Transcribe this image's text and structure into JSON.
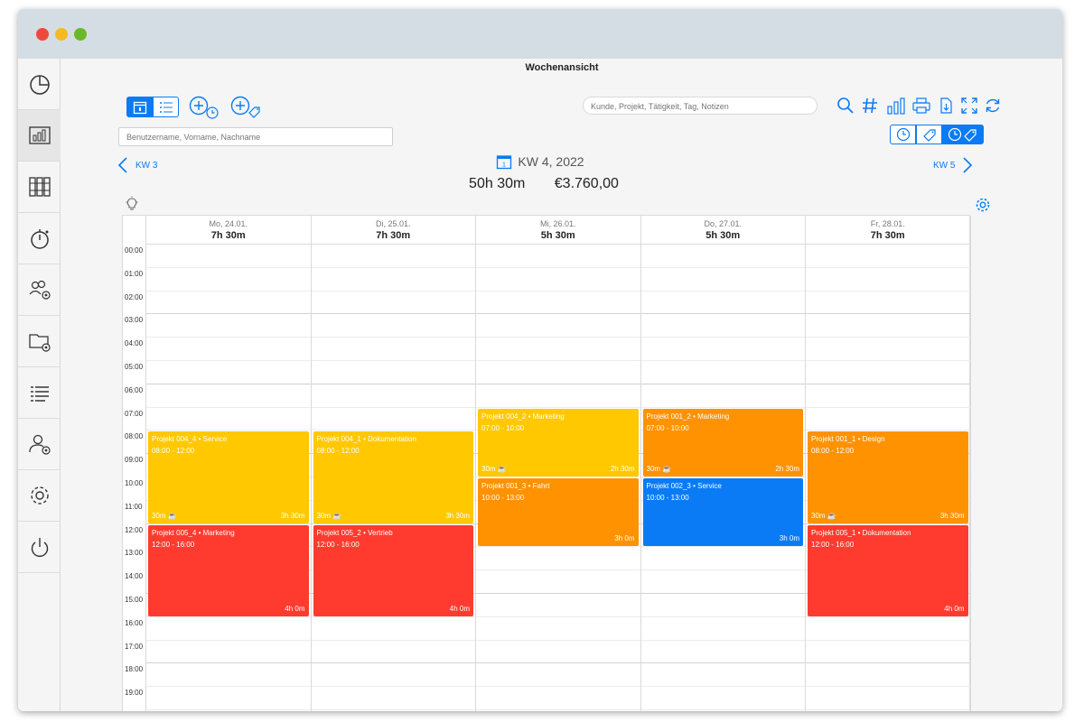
{
  "window": {
    "title": "Wochenansicht"
  },
  "sidebar": {
    "items": [
      {
        "icon": "pie-chart-icon"
      },
      {
        "icon": "bar-chart-icon"
      },
      {
        "icon": "binders-icon"
      },
      {
        "icon": "stopwatch-icon"
      },
      {
        "icon": "users-settings-icon"
      },
      {
        "icon": "folder-settings-icon"
      },
      {
        "icon": "list-icon"
      },
      {
        "icon": "user-settings-icon"
      },
      {
        "icon": "gear-icon"
      },
      {
        "icon": "power-icon"
      }
    ]
  },
  "toolbar": {
    "search_placeholder": "Kunde, Projekt, Tätigkeit, Tag, Notizen",
    "user_placeholder": "Benutzername, Vorname, Nachname"
  },
  "week": {
    "prev": "KW 3",
    "next": "KW 5",
    "label": "KW 4, 2022",
    "calendar_icon_day": "1",
    "total_hours": "50h 30m",
    "total_amount": "€3.760,00"
  },
  "days": [
    {
      "name": "Mo, 24.01.",
      "total": "7h 30m"
    },
    {
      "name": "Di, 25.01.",
      "total": "7h 30m"
    },
    {
      "name": "Mi, 26.01.",
      "total": "5h 30m"
    },
    {
      "name": "Do, 27.01.",
      "total": "5h 30m"
    },
    {
      "name": "Fr, 28.01.",
      "total": "7h 30m"
    }
  ],
  "hours": [
    "00:00",
    "01:00",
    "02:00",
    "03:00",
    "04:00",
    "05:00",
    "06:00",
    "07:00",
    "08:00",
    "09:00",
    "10:00",
    "11:00",
    "12:00",
    "13:00",
    "14:00",
    "15:00",
    "16:00",
    "17:00",
    "18:00",
    "19:00"
  ],
  "colors": {
    "yellow": "#ffc800",
    "orange": "#ff9200",
    "red": "#ff3b30",
    "blue": "#0a7bf5",
    "accent": "#0a7bf5"
  },
  "events": [
    {
      "day": 0,
      "title": "Projekt 004_4 • Service",
      "time": "08:00 - 12:00",
      "start": 8,
      "end": 12,
      "color": "yellow",
      "pause": "30m",
      "duration": "3h 30m"
    },
    {
      "day": 0,
      "title": "Projekt 005_4 • Marketing",
      "time": "12:00 - 16:00",
      "start": 12,
      "end": 16,
      "color": "red",
      "pause": "",
      "duration": "4h 0m"
    },
    {
      "day": 1,
      "title": "Projekt 004_1 • Dokumentation",
      "time": "08:00 - 12:00",
      "start": 8,
      "end": 12,
      "color": "yellow",
      "pause": "30m",
      "duration": "3h 30m"
    },
    {
      "day": 1,
      "title": "Projekt 005_2 • Vertrieb",
      "time": "12:00 - 16:00",
      "start": 12,
      "end": 16,
      "color": "red",
      "pause": "",
      "duration": "4h 0m"
    },
    {
      "day": 2,
      "title": "Projekt 004_2 • Marketing",
      "time": "07:00 - 10:00",
      "start": 7,
      "end": 10,
      "color": "yellow",
      "pause": "30m",
      "duration": "2h 30m"
    },
    {
      "day": 2,
      "title": "Projekt 001_3 • Fahrt",
      "time": "10:00 - 13:00",
      "start": 10,
      "end": 13,
      "color": "orange",
      "pause": "",
      "duration": "3h 0m"
    },
    {
      "day": 3,
      "title": "Projekt 001_2 • Marketing",
      "time": "07:00 - 10:00",
      "start": 7,
      "end": 10,
      "color": "orange",
      "pause": "30m",
      "duration": "2h 30m"
    },
    {
      "day": 3,
      "title": "Projekt 002_3 • Service",
      "time": "10:00 - 13:00",
      "start": 10,
      "end": 13,
      "color": "blue",
      "pause": "",
      "duration": "3h 0m"
    },
    {
      "day": 4,
      "title": "Projekt 001_1 • Design",
      "time": "08:00 - 12:00",
      "start": 8,
      "end": 12,
      "color": "orange",
      "pause": "30m",
      "duration": "3h 30m"
    },
    {
      "day": 4,
      "title": "Projekt 005_1 • Dokumentation",
      "time": "12:00 - 16:00",
      "start": 12,
      "end": 16,
      "color": "red",
      "pause": "",
      "duration": "4h 0m"
    }
  ]
}
